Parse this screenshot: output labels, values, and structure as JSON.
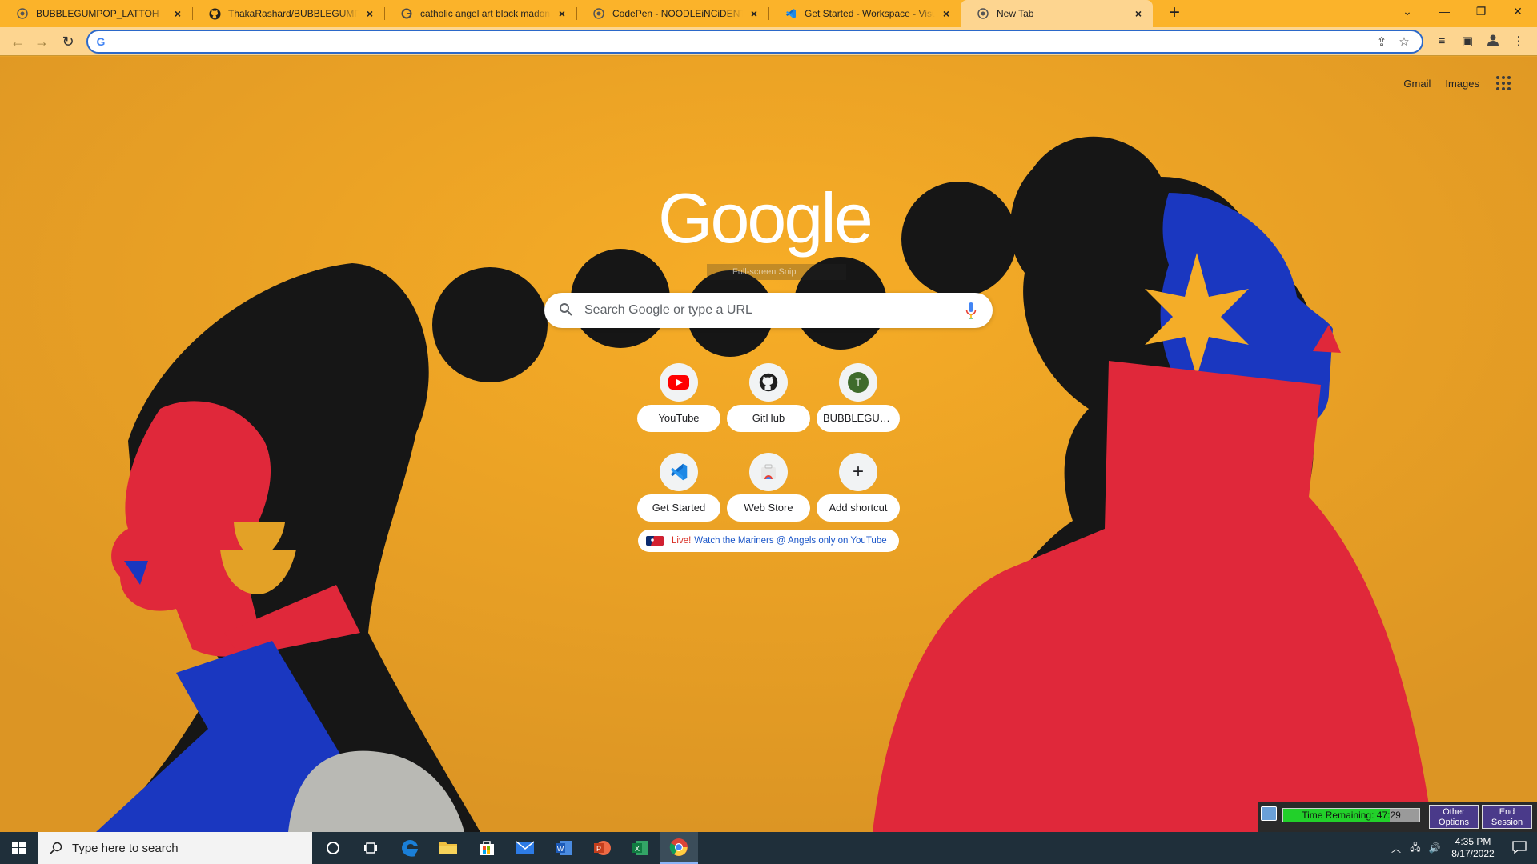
{
  "tabs": [
    {
      "title": "BUBBLEGUMPOP_LATTOH",
      "icon": "chrome-page-icon"
    },
    {
      "title": "ThakaRashard/BUBBLEGUMPOP_LATTOH",
      "icon": "github-icon"
    },
    {
      "title": "catholic angel art black madonna",
      "icon": "google-g-icon"
    },
    {
      "title": "CodePen - NOODLEiNCiDENT CE",
      "icon": "codepen-icon"
    },
    {
      "title": "Get Started - Workspace - Visual Studio Code",
      "icon": "vscode-icon"
    },
    {
      "title": "New Tab",
      "icon": "chrome-page-icon"
    }
  ],
  "active_tab": 5,
  "omnibox": {
    "value": "",
    "placeholder": ""
  },
  "ntp": {
    "top_links": {
      "gmail": "Gmail",
      "images": "Images"
    },
    "logo_text": "Google",
    "snip_hint": "Full-screen Snip",
    "search_placeholder": "Search Google or type a URL",
    "shortcuts": [
      {
        "label": "YouTube",
        "icon": "youtube-icon"
      },
      {
        "label": "GitHub",
        "icon": "github-icon"
      },
      {
        "label": "BUBBLEGUM...",
        "icon": "letter-t-icon",
        "letter": "T"
      },
      {
        "label": "Get Started",
        "icon": "vscode-icon"
      },
      {
        "label": "Web Store",
        "icon": "web-store-icon"
      },
      {
        "label": "Add shortcut",
        "icon": "plus-icon"
      }
    ],
    "promo": {
      "live": "Live!",
      "text": "Watch the Mariners @ Angels only on YouTube"
    }
  },
  "session": {
    "time_label": "Time Remaining: 47:29",
    "progress_fraction": 0.78,
    "other_options": "Other Options",
    "end_session": "End Session"
  },
  "taskbar": {
    "search_placeholder": "Type here to search",
    "time": "4:35 PM",
    "date": "8/17/2022"
  },
  "colors": {
    "tab_strip": "#fbb32a",
    "toolbar": "#fdd590",
    "background": "#e8a128",
    "accent_blue": "#2b68c9",
    "figure_red": "#e0283a",
    "figure_blue": "#1a37c0"
  }
}
